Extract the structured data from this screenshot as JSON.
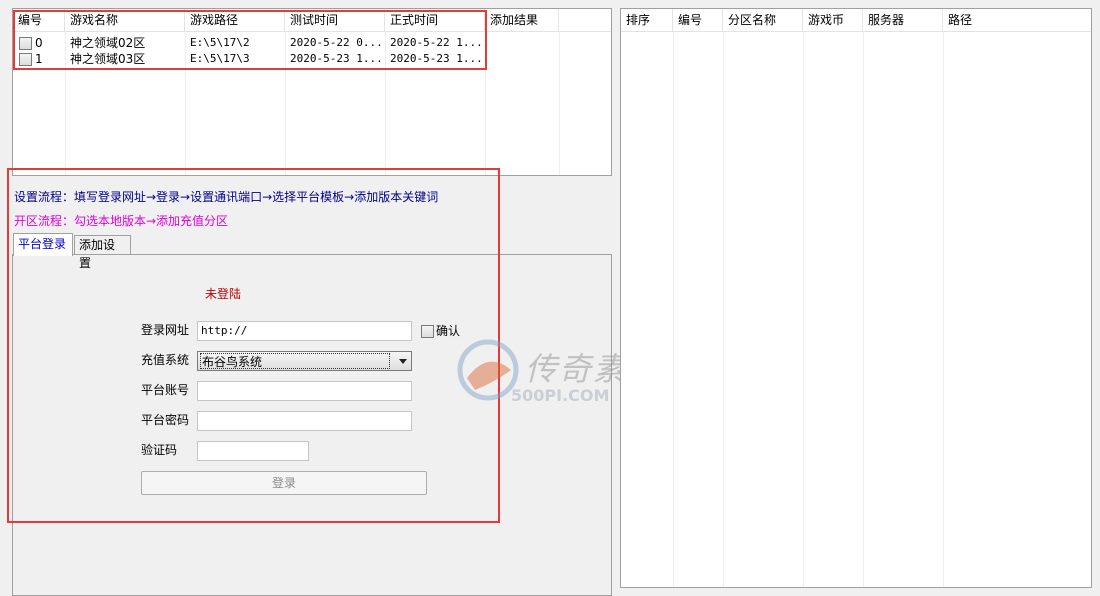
{
  "left_table": {
    "columns": [
      "编号",
      "游戏名称",
      "游戏路径",
      "测试时间",
      "正式时间",
      "添加结果"
    ],
    "rows": [
      {
        "id": "0",
        "name": "神之领域02区",
        "path": "E:\\5\\17\\2",
        "test_time": "2020-5-22 0...",
        "formal_time": "2020-5-22 1..."
      },
      {
        "id": "1",
        "name": "神之领域03区",
        "path": "E:\\5\\17\\3",
        "test_time": "2020-5-23 1...",
        "formal_time": "2020-5-23 1..."
      }
    ]
  },
  "info": {
    "setup_flow": "设置流程：填写登录网址→登录→设置通讯端口→选择平台模板→添加版本关键词",
    "open_flow": "开区流程：勾选本地版本→添加充值分区"
  },
  "tabs": [
    "平台登录",
    "添加设置"
  ],
  "login": {
    "status": "未登陆",
    "url_label": "登录网址",
    "url_value": "http://",
    "confirm_label": "确认",
    "recharge_label": "充值系统",
    "recharge_value": "布谷鸟系统",
    "account_label": "平台账号",
    "password_label": "平台密码",
    "captcha_label": "验证码",
    "login_button": "登录"
  },
  "right_table": {
    "columns": [
      "排序",
      "编号",
      "分区名称",
      "游戏币",
      "服务器",
      "路径"
    ]
  },
  "watermark": {
    "cn": "传奇素材",
    "en": "500PI.COM"
  },
  "colors": {
    "accent_blue": "#00008b",
    "accent_magenta": "#e000e0",
    "status_red": "#c00000",
    "highlight": "#e53a3a"
  }
}
